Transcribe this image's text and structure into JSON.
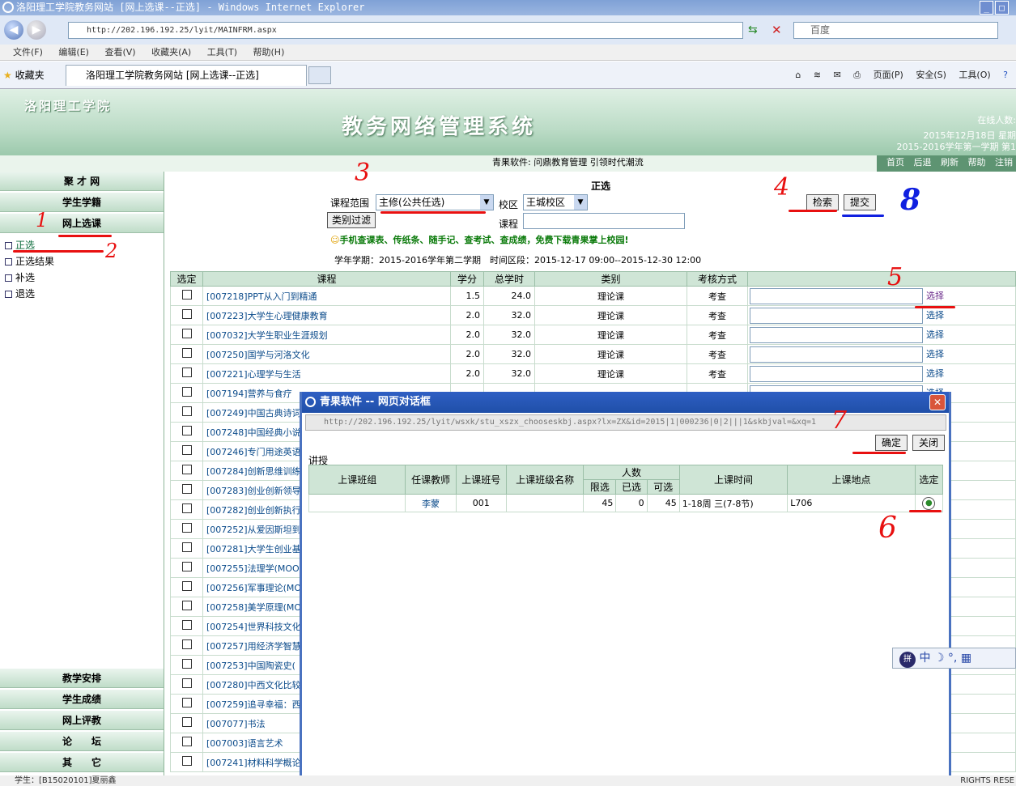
{
  "window": {
    "title": "洛阳理工学院教务网站 [网上选课--正选] - Windows Internet Explorer",
    "min": "_",
    "max": "□"
  },
  "browser": {
    "address": "http://202.196.192.25/lyit/MAINFRM.aspx",
    "search_placeholder": "百度",
    "menu": [
      "文件(F)",
      "编辑(E)",
      "查看(V)",
      "收藏夹(A)",
      "工具(T)",
      "帮助(H)"
    ],
    "favorites_label": "收藏夹",
    "tab_title": "洛阳理工学院教务网站 [网上选课--正选]",
    "tools": [
      "页面(P)",
      "安全(S)",
      "工具(O)"
    ]
  },
  "banner": {
    "school": "洛阳理工学院",
    "system_title": "教务网络管理系统",
    "online_label": "在线人数:",
    "date": "2015年12月18日 星期",
    "term": "2015-2016学年第一学期 第1"
  },
  "strip": {
    "slogan": "青果软件: 问鼎教育管理 引领时代潮流",
    "nav": [
      "首页",
      "后退",
      "刷新",
      "帮助",
      "注销"
    ]
  },
  "sidebar": {
    "top": [
      "聚 才 网",
      "学生学籍",
      "网上选课"
    ],
    "sub": [
      "正选",
      "正选结果",
      "补选",
      "退选"
    ],
    "bottom": [
      "教学安排",
      "学生成绩",
      "网上评教",
      "论　　坛",
      "其　　它"
    ]
  },
  "main": {
    "title": "正选",
    "scope_label": "课程范围",
    "scope_value": "主修(公共任选)",
    "campus_label": "校区",
    "campus_value": "王城校区",
    "search_btn": "检索",
    "submit_btn": "提交",
    "filter_btn": "类别过滤",
    "course_label": "课程",
    "promo": "手机查课表、传纸条、随手记、查考试、查成绩，免费下载青果掌上校园!",
    "term_info": "学年学期：2015-2016学年第二学期　时间区段：2015-12-17 09:00--2015-12-30 12:00",
    "headers": [
      "选定",
      "课程",
      "学分",
      "总学时",
      "类别",
      "考核方式"
    ],
    "select_link": "选择",
    "rows": [
      {
        "course": "[007218]PPT从入门到精通",
        "credit": "1.5",
        "hours": "24.0",
        "type": "理论课",
        "exam": "考查"
      },
      {
        "course": "[007223]大学生心理健康教育",
        "credit": "2.0",
        "hours": "32.0",
        "type": "理论课",
        "exam": "考查"
      },
      {
        "course": "[007032]大学生职业生涯规划",
        "credit": "2.0",
        "hours": "32.0",
        "type": "理论课",
        "exam": "考查"
      },
      {
        "course": "[007250]国学与河洛文化",
        "credit": "2.0",
        "hours": "32.0",
        "type": "理论课",
        "exam": "考查"
      },
      {
        "course": "[007221]心理学与生活",
        "credit": "2.0",
        "hours": "32.0",
        "type": "理论课",
        "exam": "考查"
      },
      {
        "course": "[007194]营养与食疗"
      },
      {
        "course": "[007249]中国古典诗词"
      },
      {
        "course": "[007248]中国经典小说"
      },
      {
        "course": "[007246]专门用途英语"
      },
      {
        "course": "[007284]创新思维训练"
      },
      {
        "course": "[007283]创业创新领导"
      },
      {
        "course": "[007282]创业创新执行"
      },
      {
        "course": "[007252]从爱因斯坦到"
      },
      {
        "course": "[007281]大学生创业基"
      },
      {
        "course": "[007255]法理学(MOOC"
      },
      {
        "course": "[007256]军事理论(MO"
      },
      {
        "course": "[007258]美学原理(MO"
      },
      {
        "course": "[007254]世界科技文化"
      },
      {
        "course": "[007257]用经济学智慧"
      },
      {
        "course": "[007253]中国陶瓷史("
      },
      {
        "course": "[007280]中西文化比较"
      },
      {
        "course": "[007259]追寻幸福：西"
      },
      {
        "course": "[007077]书法"
      },
      {
        "course": "[007003]语言艺术"
      },
      {
        "course": "[007241]材料科学概论"
      }
    ]
  },
  "dialog": {
    "title": "青果软件 -- 网页对话框",
    "close": "✕",
    "address": "http://202.196.192.25/lyit/wsxk/stu_xszx_chooseskbj.aspx?lx=ZX&id=2015|1|000236|0|2|||1&skbjval=&xq=1",
    "ok_btn": "确定",
    "close_btn": "关闭",
    "section": "讲授",
    "headers": {
      "class_group": "上课班组",
      "teacher": "任课教师",
      "class_no": "上课班号",
      "class_name": "上课班级名称",
      "people": "人数",
      "limit": "限选",
      "selected": "已选",
      "available": "可选",
      "time": "上课时间",
      "place": "上课地点",
      "choose": "选定"
    },
    "row": {
      "teacher": "李蒙",
      "class_no": "001",
      "limit": "45",
      "selected": "0",
      "available": "45",
      "time": "1-18周 三(7-8节)",
      "place": "L706"
    }
  },
  "status": {
    "left": "学生：[B15020101]夏丽鑫",
    "right": "RIGHTS RESE"
  },
  "annotations": [
    "1",
    "2",
    "3",
    "4",
    "5",
    "6",
    "7",
    "8"
  ],
  "colors": {
    "annotation_red": "#e81010",
    "annotation_blue": "#1020e0",
    "ie_blue": "#2f5fc4",
    "green_header": "#cfe5d6"
  }
}
